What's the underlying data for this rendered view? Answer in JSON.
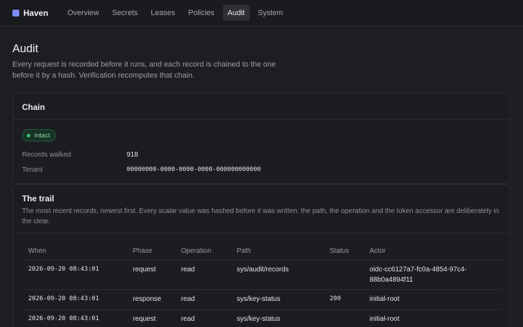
{
  "brand": {
    "name": "Haven",
    "color": "#7c8cf8"
  },
  "nav": {
    "tabs": [
      "Overview",
      "Secrets",
      "Leases",
      "Policies",
      "Audit",
      "System"
    ],
    "active": "Audit"
  },
  "page": {
    "title": "Audit",
    "intro": "Every request is recorded before it runs, and each record is chained to the one before it by a hash. Verification recomputes that chain."
  },
  "chain": {
    "heading": "Chain",
    "status": "intact",
    "records_label": "Records walked",
    "records_value": "918",
    "tenant_label": "Tenant",
    "tenant_value": "00000000-0000-0000-0000-000000000000"
  },
  "trail": {
    "heading": "The trail",
    "description": "The most recent records, newest first. Every scalar value was hashed before it was written; the path, the operation and the token accessor are deliberately in the clear.",
    "columns": [
      "When",
      "Phase",
      "Operation",
      "Path",
      "Status",
      "Actor"
    ],
    "rows": [
      {
        "when": "2026-09-20 08:43:01",
        "phase": "request",
        "operation": "read",
        "path": "sys/audit/records",
        "status": "",
        "actor": "oidc-cc6127a7-fc0a-4854-97c4-88b0a4894f11"
      },
      {
        "when": "2026-09-20 08:43:01",
        "phase": "response",
        "operation": "read",
        "path": "sys/key-status",
        "status": "200",
        "actor": "initial-root"
      },
      {
        "when": "2026-09-20 08:43:01",
        "phase": "request",
        "operation": "read",
        "path": "sys/key-status",
        "status": "",
        "actor": "initial-root"
      }
    ]
  }
}
